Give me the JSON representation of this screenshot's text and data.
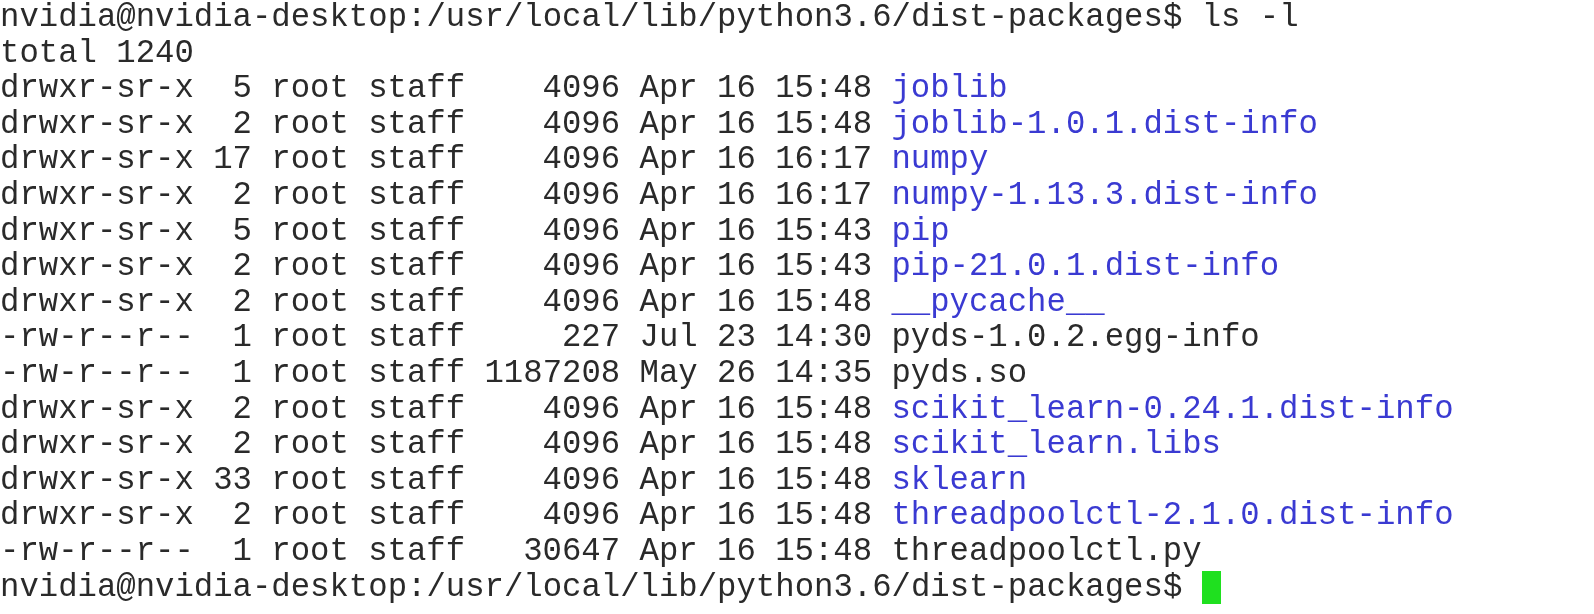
{
  "command_line": {
    "prompt": "nvidia@nvidia-desktop:/usr/local/lib/python3.6/dist-packages$",
    "command": "ls -l"
  },
  "total": "total 1240",
  "entries": [
    {
      "permissions": "drwxr-sr-x",
      "links": "5",
      "owner": "root",
      "group": "staff",
      "size": "4096",
      "date": "Apr 16 15:48",
      "name": "joblib",
      "kind": "dir"
    },
    {
      "permissions": "drwxr-sr-x",
      "links": "2",
      "owner": "root",
      "group": "staff",
      "size": "4096",
      "date": "Apr 16 15:48",
      "name": "joblib-1.0.1.dist-info",
      "kind": "dir"
    },
    {
      "permissions": "drwxr-sr-x",
      "links": "17",
      "owner": "root",
      "group": "staff",
      "size": "4096",
      "date": "Apr 16 16:17",
      "name": "numpy",
      "kind": "dir"
    },
    {
      "permissions": "drwxr-sr-x",
      "links": "2",
      "owner": "root",
      "group": "staff",
      "size": "4096",
      "date": "Apr 16 16:17",
      "name": "numpy-1.13.3.dist-info",
      "kind": "dir"
    },
    {
      "permissions": "drwxr-sr-x",
      "links": "5",
      "owner": "root",
      "group": "staff",
      "size": "4096",
      "date": "Apr 16 15:43",
      "name": "pip",
      "kind": "dir"
    },
    {
      "permissions": "drwxr-sr-x",
      "links": "2",
      "owner": "root",
      "group": "staff",
      "size": "4096",
      "date": "Apr 16 15:43",
      "name": "pip-21.0.1.dist-info",
      "kind": "dir"
    },
    {
      "permissions": "drwxr-sr-x",
      "links": "2",
      "owner": "root",
      "group": "staff",
      "size": "4096",
      "date": "Apr 16 15:48",
      "name": "__pycache__",
      "kind": "dir"
    },
    {
      "permissions": "-rw-r--r--",
      "links": "1",
      "owner": "root",
      "group": "staff",
      "size": "227",
      "date": "Jul 23 14:30",
      "name": "pyds-1.0.2.egg-info",
      "kind": "file"
    },
    {
      "permissions": "-rw-r--r--",
      "links": "1",
      "owner": "root",
      "group": "staff",
      "size": "1187208",
      "date": "May 26 14:35",
      "name": "pyds.so",
      "kind": "file"
    },
    {
      "permissions": "drwxr-sr-x",
      "links": "2",
      "owner": "root",
      "group": "staff",
      "size": "4096",
      "date": "Apr 16 15:48",
      "name": "scikit_learn-0.24.1.dist-info",
      "kind": "dir"
    },
    {
      "permissions": "drwxr-sr-x",
      "links": "2",
      "owner": "root",
      "group": "staff",
      "size": "4096",
      "date": "Apr 16 15:48",
      "name": "scikit_learn.libs",
      "kind": "dir"
    },
    {
      "permissions": "drwxr-sr-x",
      "links": "33",
      "owner": "root",
      "group": "staff",
      "size": "4096",
      "date": "Apr 16 15:48",
      "name": "sklearn",
      "kind": "dir"
    },
    {
      "permissions": "drwxr-sr-x",
      "links": "2",
      "owner": "root",
      "group": "staff",
      "size": "4096",
      "date": "Apr 16 15:48",
      "name": "threadpoolctl-2.1.0.dist-info",
      "kind": "dir"
    },
    {
      "permissions": "-rw-r--r--",
      "links": "1",
      "owner": "root",
      "group": "staff",
      "size": "30647",
      "date": "Apr 16 15:48",
      "name": "threadpoolctl.py",
      "kind": "file"
    }
  ],
  "final_prompt": "nvidia@nvidia-desktop:/usr/local/lib/python3.6/dist-packages$"
}
